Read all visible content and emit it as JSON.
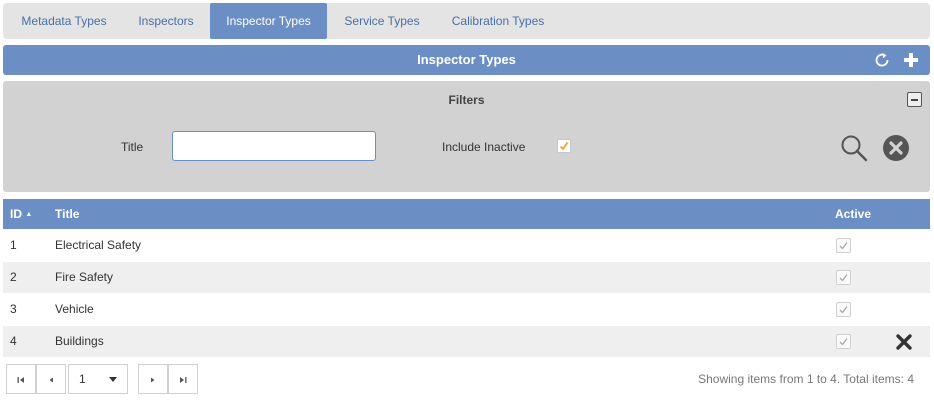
{
  "tabs": [
    {
      "label": "Metadata Types"
    },
    {
      "label": "Inspectors"
    },
    {
      "label": "Inspector Types"
    },
    {
      "label": "Service Types"
    },
    {
      "label": "Calibration Types"
    }
  ],
  "active_tab": "Inspector Types",
  "header": {
    "title": "Inspector Types",
    "refresh_icon": "refresh-icon",
    "add_icon": "plus-icon"
  },
  "filters": {
    "title": "Filters",
    "title_label": "Title",
    "title_value": "",
    "include_inactive_label": "Include Inactive",
    "include_inactive_checked": true,
    "search_icon": "search-icon",
    "clear_icon": "clear-circle-x-icon"
  },
  "grid": {
    "columns": {
      "id": "ID",
      "title": "Title",
      "active": "Active"
    },
    "sort": {
      "column": "ID",
      "direction": "ascending"
    },
    "rows": [
      {
        "id": "1",
        "title": "Electrical Safety",
        "active": true
      },
      {
        "id": "2",
        "title": "Fire Safety",
        "active": true
      },
      {
        "id": "3",
        "title": "Vehicle",
        "active": true
      },
      {
        "id": "4",
        "title": "Buildings",
        "active": true
      }
    ]
  },
  "pager": {
    "page": "1",
    "info": "Showing items from 1 to 4. Total items: 4"
  },
  "colors": {
    "accent": "#6b8fc4",
    "tab_text": "#4a6fa5",
    "filter_bg": "#d2d2d2",
    "checkbox_orange": "#f0a030"
  }
}
